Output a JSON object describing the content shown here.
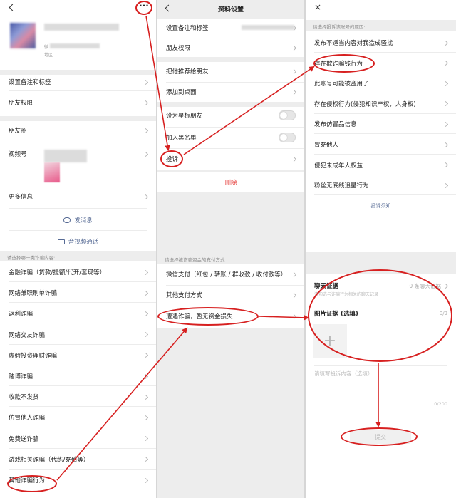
{
  "profile": {
    "more_icon": "ellipsis-icon",
    "rows": [
      {
        "label": "设置备注和标签"
      },
      {
        "label": "朋友权限"
      },
      {
        "label": "朋友圈"
      },
      {
        "label": "视频号"
      },
      {
        "label": "更多信息"
      }
    ],
    "wechat_prefix": "微",
    "region_prefix": "地区",
    "send_message": "发消息",
    "video_call": "音视频通话",
    "fraud_header": "请选择哪一类诈骗内容:",
    "fraud_types": [
      "金融诈骗（贷款/提额/代开/套现等）",
      "网络兼职刷单诈骗",
      "返利诈骗",
      "网络交友诈骗",
      "虚假投资理财诈骗",
      "赌博诈骗",
      "收款不发货",
      "仿冒他人诈骗",
      "免费送诈骗",
      "游戏相关诈骗（代练/充值等）",
      "其他诈骗行为"
    ]
  },
  "settings": {
    "title": "资料设置",
    "rows_a": [
      "设置备注和标签",
      "朋友权限"
    ],
    "rows_b": [
      "把他推荐给朋友",
      "添加到桌面"
    ],
    "rows_c": [
      "设为星标朋友",
      "加入黑名单"
    ],
    "complain": "投诉",
    "delete": "删除",
    "pay_header": "请选择被诈骗资金的支付方式",
    "pay_methods": [
      "微信支付（红包 / 转账 / 群收款 / 收付款等）",
      "其他支付方式",
      "遭遇诈骗，暂无资金损失"
    ]
  },
  "complaint": {
    "header": "请选择投诉该账号的原因:",
    "reasons": [
      "发布不适当内容对我造成骚扰",
      "存在欺诈骗钱行为",
      "此账号可能被盗用了",
      "存在侵权行为(侵犯知识产权，人身权)",
      "发布仿冒品信息",
      "冒充他人",
      "侵犯未成年人权益",
      "粉丝无底线追星行为"
    ],
    "guide": "投诉须知",
    "chat_evidence": "聊天证据",
    "chat_count": "0 条聊天证据",
    "chat_hint": "请勾选与诈骗行为相关的聊天记录",
    "image_evidence": "图片证据 (选填)",
    "image_count": "0/9",
    "desc_placeholder": "请填写投诉内容（选填）",
    "desc_count": "0/200",
    "submit": "提交"
  },
  "colors": {
    "annotation_red": "#d72020",
    "delete_red": "#e64340",
    "link_blue": "#576b95"
  }
}
